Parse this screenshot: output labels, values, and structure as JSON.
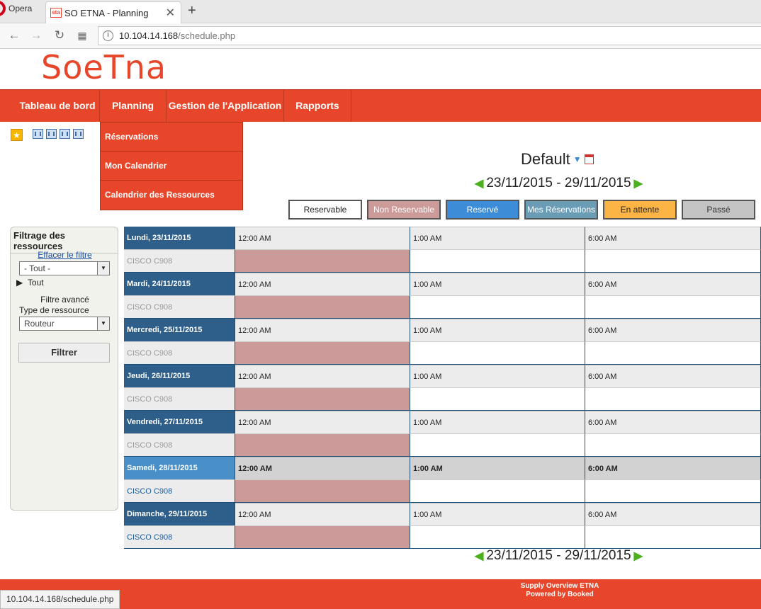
{
  "browser": {
    "opera_label": "Opera",
    "tab_title": "SO ETNA - Planning",
    "tab_favicon": "sta",
    "url_host": "10.104.14.168",
    "url_path": "/schedule.php"
  },
  "logo": "SoeTna",
  "nav": {
    "items": [
      "Tableau de bord",
      "Planning",
      "Gestion de l'Application",
      "Rapports"
    ]
  },
  "planning_menu": [
    "Réservations",
    "Mon Calendrier",
    "Calendrier des Ressources"
  ],
  "schedule": {
    "title": "Default",
    "date_range": "23/11/2015 - 29/11/2015"
  },
  "legend": [
    {
      "label": "Reservable",
      "bg": "#ffffff",
      "color": "#222222"
    },
    {
      "label": "Non Reservable",
      "bg": "#cd9a9a",
      "color": "#ffffff"
    },
    {
      "label": "Reservé",
      "bg": "#3c8cd8",
      "color": "#ffffff"
    },
    {
      "label": "Mes Réservations",
      "bg": "#6b9cb5",
      "color": "#ffffff"
    },
    {
      "label": "En attente",
      "bg": "#fcb445",
      "color": "#222222"
    },
    {
      "label": "Passé",
      "bg": "#c4c4c4",
      "color": "#333333"
    }
  ],
  "filter": {
    "title": "Filtrage des ressources",
    "clear_link": "Effacer le filtre",
    "select_value": "- Tout -",
    "tree_item": "Tout",
    "advanced_label": "Filtre avancé",
    "type_label": "Type de ressource",
    "type_value": "Routeur",
    "submit": "Filtrer"
  },
  "times": [
    "12:00 AM",
    "1:00 AM",
    "6:00 AM"
  ],
  "days": [
    {
      "date": "Lundi, 23/11/2015",
      "resource": "CISCO C908",
      "today": false
    },
    {
      "date": "Mardi, 24/11/2015",
      "resource": "CISCO C908",
      "today": false
    },
    {
      "date": "Mercredi, 25/11/2015",
      "resource": "CISCO C908",
      "today": false
    },
    {
      "date": "Jeudi, 26/11/2015",
      "resource": "CISCO C908",
      "today": false
    },
    {
      "date": "Vendredi, 27/11/2015",
      "resource": "CISCO C908",
      "today": false
    },
    {
      "date": "Samedi, 28/11/2015",
      "resource": "CISCO C908",
      "today": true
    },
    {
      "date": "Dimanche, 29/11/2015",
      "resource": "CISCO C908",
      "today": false
    }
  ],
  "footer": {
    "line1": "Supply Overview ETNA",
    "line2": "Powered by Booked"
  },
  "status_url": "10.104.14.168/schedule.php"
}
